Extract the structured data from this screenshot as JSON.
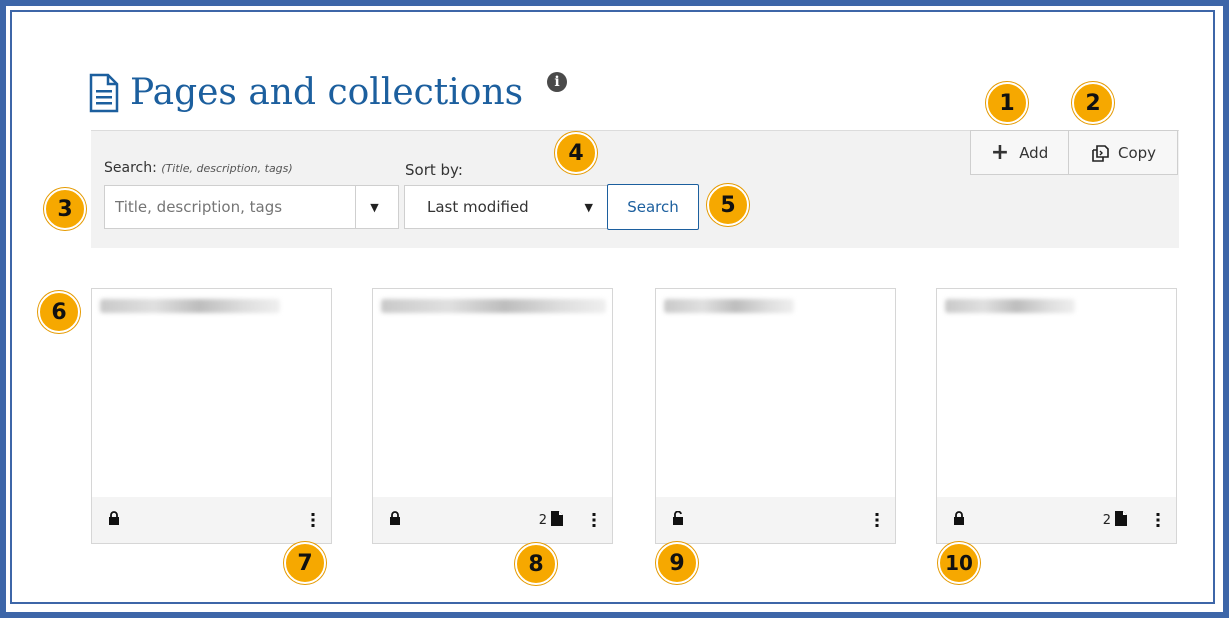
{
  "header": {
    "title": "Pages and collections",
    "info_glyph": "i"
  },
  "toolbar": {
    "add_label": "Add",
    "copy_label": "Copy"
  },
  "search": {
    "label": "Search:",
    "hint": "(Title, description, tags)",
    "placeholder": "Title, description, tags",
    "dropdown_caret": "▼",
    "sort_label": "Sort by:",
    "sort_value": "Last modified",
    "sort_caret": "▼",
    "button_label": "Search"
  },
  "cards": [
    {
      "title": "Learning resources",
      "collection": false,
      "locked": true,
      "page_count": ""
    },
    {
      "title": "Teaching methods collection",
      "collection": true,
      "locked": true,
      "page_count": "2"
    },
    {
      "title": "Project notes",
      "collection": false,
      "locked": false,
      "page_count": ""
    },
    {
      "title": "Reflections",
      "collection": true,
      "locked": true,
      "page_count": "2"
    }
  ],
  "callouts": [
    "1",
    "2",
    "3",
    "4",
    "5",
    "6",
    "7",
    "8",
    "9",
    "10"
  ],
  "colors": {
    "accent": "#1c5f9e",
    "badge": "#f6a800",
    "frame": "#3d66a8"
  },
  "icons": {
    "title": "document-icon",
    "info": "info-icon",
    "add": "plus-icon",
    "copy": "copy-icon",
    "lock": "lock-icon",
    "unlock": "unlock-icon",
    "pages": "file-icon",
    "menu": "kebab-icon"
  }
}
